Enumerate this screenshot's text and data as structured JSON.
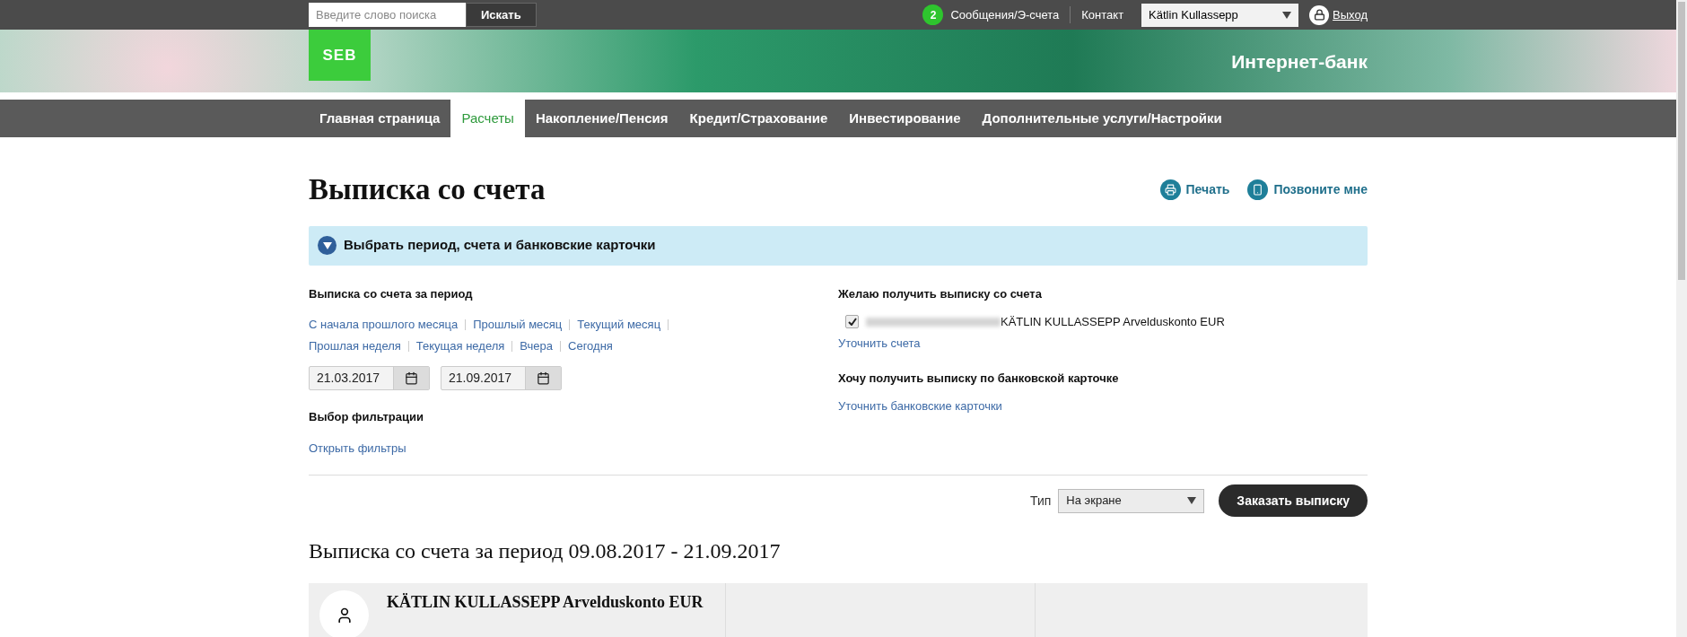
{
  "top_bar": {
    "search": {
      "placeholder": "Введите слово поиска",
      "button": "Искать"
    },
    "messages": {
      "count": "2",
      "label": "Сообщения/Э-счета"
    },
    "contact": "Контакт",
    "user_select": "Kätlin Kullassepp",
    "logout": "Выход"
  },
  "banner": {
    "logo": "SEB",
    "title": "Интернет-банк"
  },
  "nav": [
    {
      "label": "Главная страница",
      "selected": false
    },
    {
      "label": "Расчеты",
      "selected": true
    },
    {
      "label": "Накопление/Пенсия",
      "selected": false
    },
    {
      "label": "Кредит/Страхование",
      "selected": false
    },
    {
      "label": "Инвестирование",
      "selected": false
    },
    {
      "label": "Дополнительные услуги/Настройки",
      "selected": false
    }
  ],
  "page": {
    "title": "Выписка со счета",
    "actions": [
      {
        "kind": "print",
        "label": "Печать"
      },
      {
        "kind": "phone",
        "label": "Позвоните мне"
      }
    ]
  },
  "panel": {
    "title": "Выбрать период, счета и банковские карточки",
    "expanded": true
  },
  "period": {
    "label": "Выписка со счета за период",
    "links": [
      "С начала прошлого месяца",
      "Прошлый месяц",
      "Текущий месяц",
      "Прошлая неделя",
      "Текущая неделя",
      "Вчера",
      "Сегодня"
    ],
    "from": "21.03.2017",
    "to": "21.09.2017"
  },
  "filters": {
    "label": "Выбор фильтрации",
    "link": "Открыть фильтры"
  },
  "accounts": {
    "label": "Желаю получить выписку со счета",
    "items": [
      {
        "name": "KÄTLIN KULLASSEPP Arvelduskonto EUR",
        "checked": true
      }
    ],
    "link": "Уточнить счета"
  },
  "cards": {
    "label": "Хочу получить выписку по банковской карточке",
    "link": "Уточнить банковские карточки"
  },
  "order": {
    "type_label": "Тип",
    "type_value": "На экране",
    "button": "Заказать выписку"
  },
  "result": {
    "title": "Выписка со счета за период 09.08.2017 - 21.09.2017",
    "account": "KÄTLIN KULLASSEPP Arvelduskonto EUR"
  }
}
